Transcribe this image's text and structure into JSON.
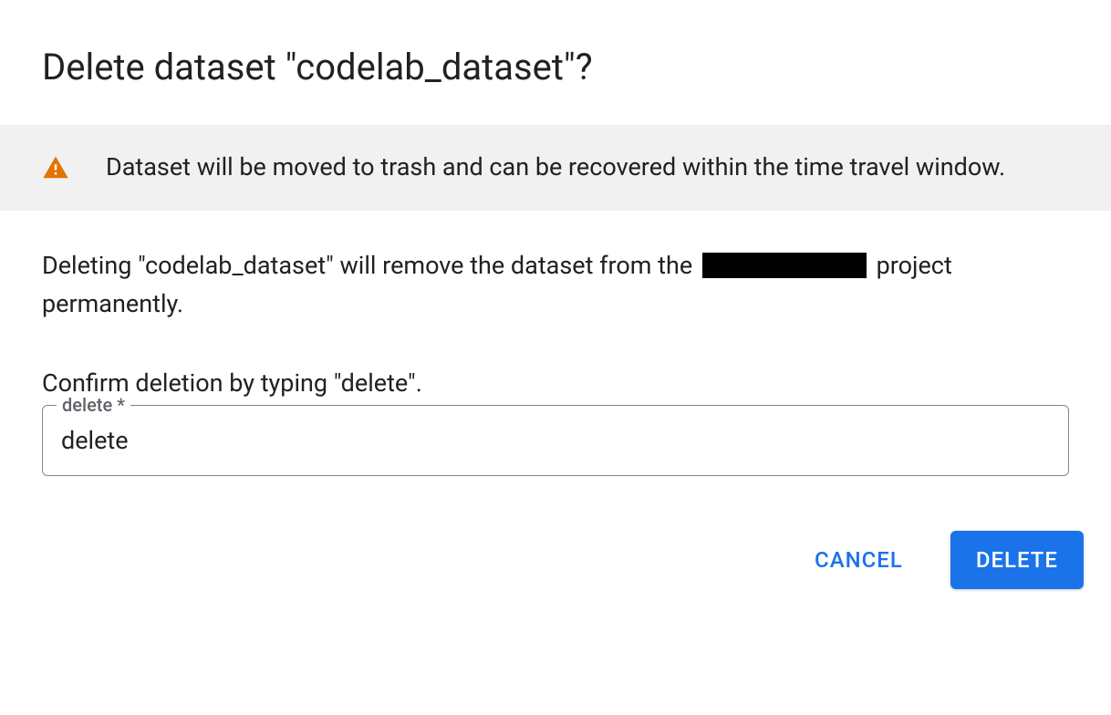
{
  "dialog": {
    "title": "Delete dataset \"codelab_dataset\"?",
    "banner": {
      "text": "Dataset will be moved to trash and can be recovered within the time travel window."
    },
    "description_part1": "Deleting \"codelab_dataset\" will remove the dataset from the ",
    "description_part2": " project permanently.",
    "confirm_instruction": "Confirm deletion by typing \"delete\".",
    "input": {
      "label": "delete *",
      "value": "delete"
    },
    "buttons": {
      "cancel": "CANCEL",
      "delete": "DELETE"
    }
  }
}
